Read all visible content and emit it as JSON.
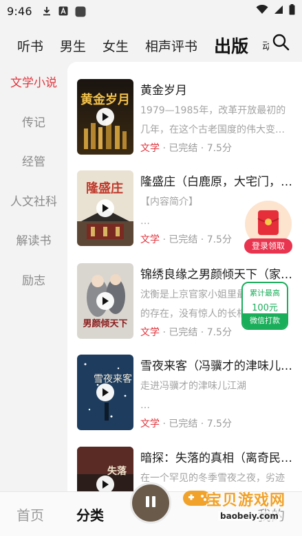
{
  "status_bar": {
    "time": "9:46"
  },
  "top_tabs": [
    {
      "label": "听书"
    },
    {
      "label": "男生"
    },
    {
      "label": "女生"
    },
    {
      "label": "相声评书"
    },
    {
      "label": "出版",
      "active": true
    },
    {
      "label": "动"
    }
  ],
  "sidebar": {
    "items": [
      {
        "label": "文学小说",
        "active": true
      },
      {
        "label": "传记"
      },
      {
        "label": "经管"
      },
      {
        "label": "人文社科"
      },
      {
        "label": "解读书"
      },
      {
        "label": "励志"
      }
    ]
  },
  "books": [
    {
      "title": "黄金岁月",
      "desc_line1": "1979—1985年，改革开放最初的",
      "desc_line2": "几年，在这个古老国度的伟大变…",
      "category": "文学",
      "meta": " · 已完结 · 7.5分",
      "cover_text": "黄金岁月"
    },
    {
      "title": "隆盛庄（白鹿原，大宅门，…",
      "desc_line1": "【内容简介】",
      "desc_line2": "…",
      "category": "文学",
      "meta": " · 已完结 · 7.5分",
      "cover_text": "隆盛庄"
    },
    {
      "title": "锦绣良缘之男颜倾天下（家…",
      "desc_line1": "沈衡是上京官家小姐里最不起眼",
      "desc_line2": "的存在，没有惊人的长相…",
      "category": "文学",
      "meta": " · 已完结 · 7.5分",
      "cover_text": "男颜倾天下"
    },
    {
      "title": "雪夜来客（冯骥才的津味儿…",
      "desc_line1": "走进冯骥才的津味儿江湖",
      "desc_line2": "…",
      "category": "文学",
      "meta": " · 已完结 · 7.5分",
      "cover_text": "雪夜来客"
    },
    {
      "title": "暗探：失落的真相（离奇民…",
      "desc_line1": "在一个罕见的冬季雪夜之夜，劣迹",
      "desc_line2": "",
      "category": "",
      "meta": "",
      "cover_text": "失落"
    }
  ],
  "red_packet": {
    "label": "登录领取"
  },
  "wechat_reward": {
    "line1": "累计最高",
    "line2": "100元",
    "line3": "微信打款"
  },
  "bottom_nav": {
    "home": "首页",
    "category": "分类",
    "mine": "我的"
  },
  "watermark": {
    "text": "宝贝游戏网",
    "url": "baobeiy.com"
  },
  "colors": {
    "accent": "#e2343c",
    "wechat_green": "#1aae5a",
    "watermark": "#f0a22a"
  }
}
